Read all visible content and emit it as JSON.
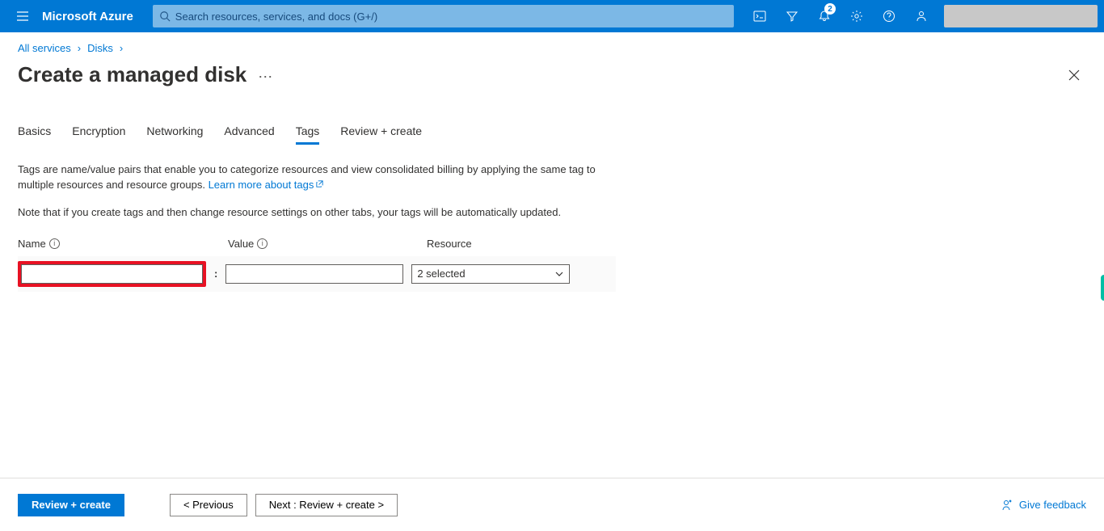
{
  "header": {
    "brand": "Microsoft Azure",
    "search_placeholder": "Search resources, services, and docs (G+/)",
    "notification_count": "2"
  },
  "breadcrumb": {
    "items": [
      "All services",
      "Disks"
    ]
  },
  "title": "Create a managed disk",
  "tabs": [
    "Basics",
    "Encryption",
    "Networking",
    "Advanced",
    "Tags",
    "Review + create"
  ],
  "active_tab_index": 4,
  "description_text": "Tags are name/value pairs that enable you to categorize resources and view consolidated billing by applying the same tag to multiple resources and resource groups. ",
  "description_link": "Learn more about tags",
  "note_text": "Note that if you create tags and then change resource settings on other tabs, your tags will be automatically updated.",
  "columns": {
    "name": "Name",
    "value": "Value",
    "resource": "Resource"
  },
  "form": {
    "name_value_sep": ":",
    "resource_selected": "2 selected"
  },
  "footer": {
    "review": "Review + create",
    "previous": "< Previous",
    "next": "Next : Review + create >",
    "feedback": "Give feedback"
  }
}
